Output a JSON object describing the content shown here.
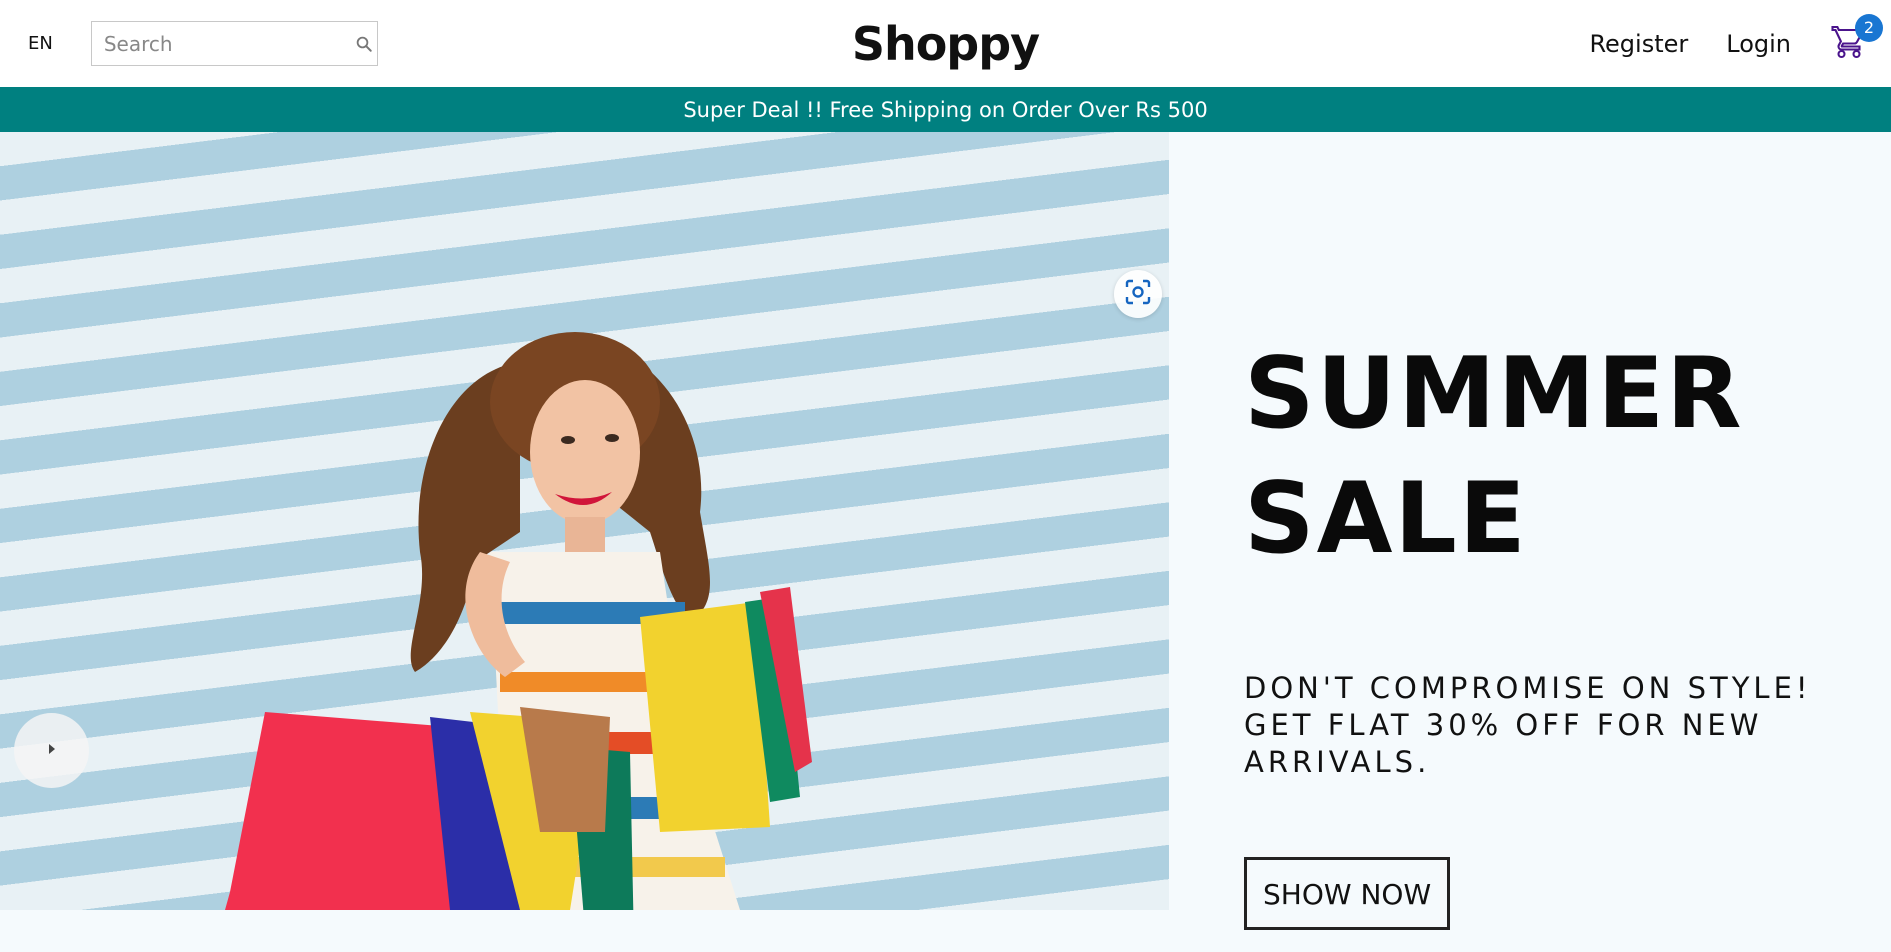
{
  "header": {
    "language": "EN",
    "search": {
      "placeholder": "Search",
      "value": ""
    },
    "logo": "Shoppy",
    "register_label": "Register",
    "login_label": "Login",
    "cart_count": "2"
  },
  "announcement": {
    "text": "Super Deal !! Free Shipping on Order Over Rs 500"
  },
  "hero": {
    "title_line1": "SUMMER",
    "title_line2": "SALE",
    "description": "DON'T COMPROMISE ON STYLE! GET FLAT 30% OFF FOR NEW ARRIVALS.",
    "button_label": "SHOW NOW"
  },
  "colors": {
    "announcement_bg": "#008080",
    "hero_bg": "#f5fafd",
    "badge": "#1976d2",
    "cart_icon": "#4a148c"
  },
  "icons": {
    "search": "search-icon",
    "cart": "cart-icon",
    "lens": "visual-search-icon",
    "slider_left": "arrow-left-icon"
  }
}
